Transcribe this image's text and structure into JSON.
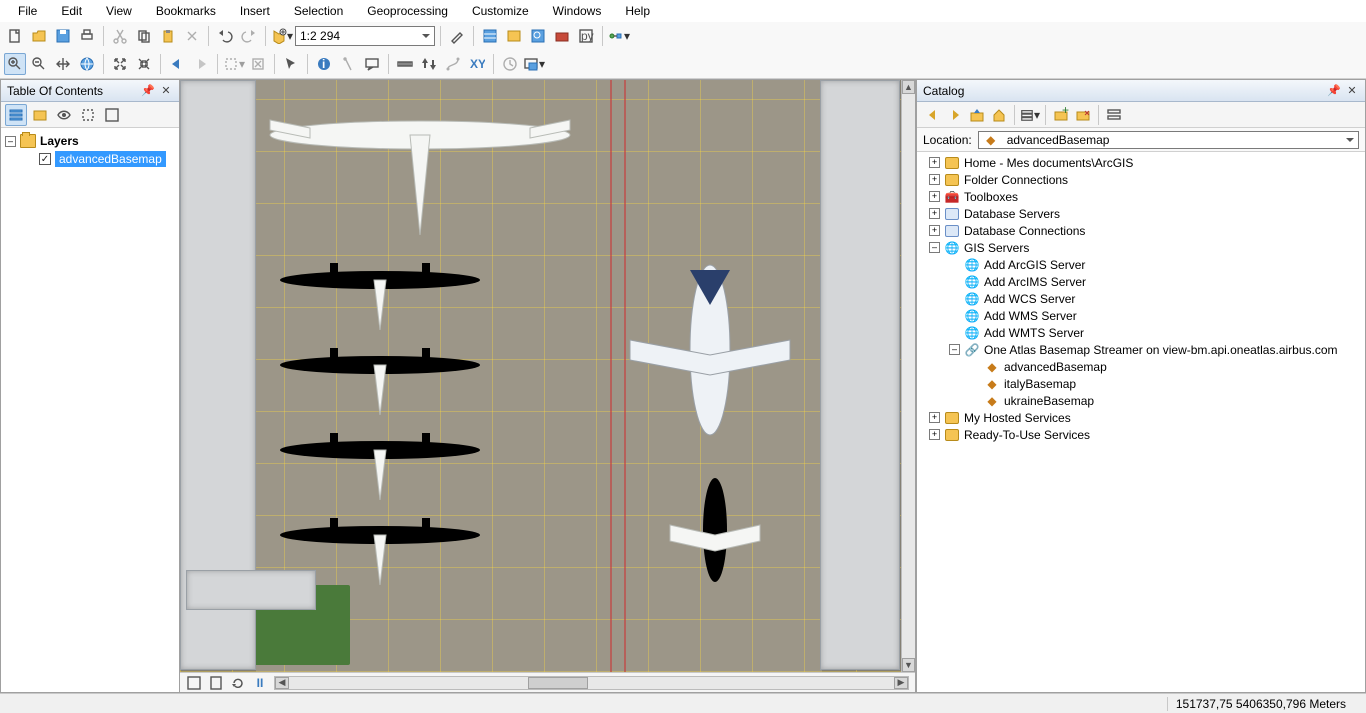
{
  "menubar": [
    "File",
    "Edit",
    "View",
    "Bookmarks",
    "Insert",
    "Selection",
    "Geoprocessing",
    "Customize",
    "Windows",
    "Help"
  ],
  "standard_toolbar": {
    "scale_value": "1:2 294",
    "buttons": [
      {
        "name": "new-doc-icon"
      },
      {
        "name": "open-icon"
      },
      {
        "name": "save-icon"
      },
      {
        "name": "print-icon"
      },
      {
        "sep": true
      },
      {
        "name": "cut-icon",
        "disabled": true
      },
      {
        "name": "copy-icon"
      },
      {
        "name": "paste-icon"
      },
      {
        "name": "delete-icon",
        "disabled": true
      },
      {
        "sep": true
      },
      {
        "name": "undo-icon"
      },
      {
        "name": "redo-icon",
        "disabled": true
      },
      {
        "sep": true
      },
      {
        "name": "add-data-icon"
      }
    ],
    "right_buttons": [
      {
        "name": "editor-toolbar-icon"
      },
      {
        "sep": true
      },
      {
        "name": "table-window-icon"
      },
      {
        "name": "table-of-contents-icon"
      },
      {
        "name": "catalog-window-icon"
      },
      {
        "name": "search-window-icon"
      },
      {
        "name": "python-window-icon"
      },
      {
        "sep": true
      },
      {
        "name": "model-builder-icon"
      }
    ]
  },
  "tools_toolbar": [
    {
      "name": "zoom-in-icon",
      "active": true
    },
    {
      "name": "zoom-out-icon"
    },
    {
      "name": "pan-icon"
    },
    {
      "name": "full-extent-icon"
    },
    {
      "sep": true
    },
    {
      "name": "fixed-zoom-in-icon"
    },
    {
      "name": "fixed-zoom-out-icon"
    },
    {
      "sep": true
    },
    {
      "name": "back-extent-icon"
    },
    {
      "name": "forward-extent-icon",
      "disabled": true
    },
    {
      "sep": true
    },
    {
      "name": "select-features-icon",
      "disabled": true
    },
    {
      "name": "clear-selection-icon",
      "disabled": true
    },
    {
      "sep": true
    },
    {
      "name": "select-elements-icon"
    },
    {
      "sep": true
    },
    {
      "name": "identify-icon"
    },
    {
      "name": "hyperlink-icon",
      "disabled": true
    },
    {
      "name": "html-popup-icon"
    },
    {
      "sep": true
    },
    {
      "name": "measure-icon"
    },
    {
      "name": "find-icon"
    },
    {
      "name": "find-route-icon",
      "disabled": true
    },
    {
      "name": "goto-xy-icon"
    },
    {
      "sep": true
    },
    {
      "name": "time-slider-icon",
      "disabled": true
    },
    {
      "name": "create-viewer-icon"
    }
  ],
  "toc": {
    "title": "Table Of Contents",
    "layers_label": "Layers",
    "layer0": "advancedBasemap"
  },
  "map_footer_icons": [
    {
      "name": "data-view-icon"
    },
    {
      "name": "layout-view-icon"
    },
    {
      "name": "refresh-icon"
    },
    {
      "name": "pause-drawing-icon"
    }
  ],
  "catalog": {
    "title": "Catalog",
    "location_label": "Location:",
    "location_value": "advancedBasemap",
    "tree": [
      {
        "depth": 0,
        "exp": "plus",
        "icon": "folder",
        "label": "Home - Mes documents\\ArcGIS"
      },
      {
        "depth": 0,
        "exp": "plus",
        "icon": "folder",
        "label": "Folder Connections"
      },
      {
        "depth": 0,
        "exp": "plus",
        "icon": "toolbox",
        "label": "Toolboxes"
      },
      {
        "depth": 0,
        "exp": "plus",
        "icon": "db",
        "label": "Database Servers"
      },
      {
        "depth": 0,
        "exp": "plus",
        "icon": "db",
        "label": "Database Connections"
      },
      {
        "depth": 0,
        "exp": "minus",
        "icon": "globe",
        "label": "GIS Servers"
      },
      {
        "depth": 1,
        "exp": "",
        "icon": "addsvr",
        "label": "Add ArcGIS Server"
      },
      {
        "depth": 1,
        "exp": "",
        "icon": "addsvr",
        "label": "Add ArcIMS Server"
      },
      {
        "depth": 1,
        "exp": "",
        "icon": "addsvr",
        "label": "Add WCS Server"
      },
      {
        "depth": 1,
        "exp": "",
        "icon": "addsvr",
        "label": "Add WMS Server"
      },
      {
        "depth": 1,
        "exp": "",
        "icon": "addsvr",
        "label": "Add WMTS Server"
      },
      {
        "depth": 1,
        "exp": "minus",
        "icon": "connection",
        "label": "One Atlas Basemap Streamer on view-bm.api.oneatlas.airbus.com"
      },
      {
        "depth": 2,
        "exp": "",
        "icon": "basemap",
        "label": "advancedBasemap"
      },
      {
        "depth": 2,
        "exp": "",
        "icon": "basemap",
        "label": "italyBasemap"
      },
      {
        "depth": 2,
        "exp": "",
        "icon": "basemap",
        "label": "ukraineBasemap"
      },
      {
        "depth": 0,
        "exp": "plus",
        "icon": "folder",
        "label": "My Hosted Services"
      },
      {
        "depth": 0,
        "exp": "plus",
        "icon": "folder",
        "label": "Ready-To-Use Services"
      }
    ],
    "toolbar_buttons": [
      {
        "name": "back-icon"
      },
      {
        "name": "forward-icon"
      },
      {
        "name": "up-one-level-icon"
      },
      {
        "name": "home-icon"
      },
      {
        "sep": true
      },
      {
        "name": "toggle-contents-icon"
      },
      {
        "sep": true
      },
      {
        "name": "connect-folder-icon"
      },
      {
        "name": "disconnect-icon"
      },
      {
        "sep": true
      },
      {
        "name": "options-icon"
      }
    ]
  },
  "status": {
    "coords": "151737,75  5406350,796 Meters"
  }
}
